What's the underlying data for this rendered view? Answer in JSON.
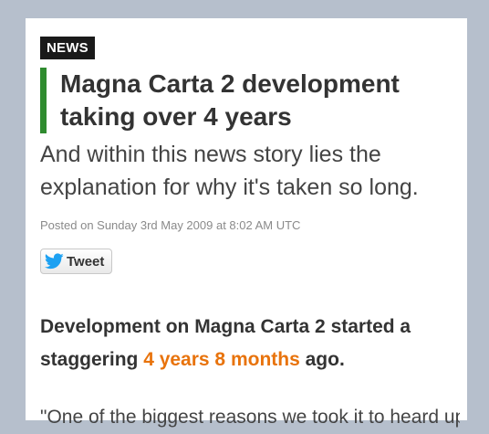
{
  "article": {
    "badge": "NEWS",
    "title": "Magna Carta 2 development taking over 4 years",
    "subtitle": "And within this news story lies the explanation for why it's taken so long.",
    "posted": "Posted on Sunday 3rd May 2009 at 8:02 AM UTC",
    "tweet_label": "Tweet",
    "development": {
      "before": "Development on Magna Carta 2 started a staggering ",
      "highlight": "4 years 8 months",
      "after": " ago."
    },
    "quote_start": "\"One of the biggest reasons we took it to heard up to"
  },
  "colors": {
    "background": "#b6bfcc",
    "accent_bar": "#2f8b2f",
    "highlight": "#e8730c",
    "badge_bg": "#1a1a1a",
    "twitter_blue": "#1da1f2"
  },
  "icons": {
    "tweet": "twitter-bird-icon"
  }
}
